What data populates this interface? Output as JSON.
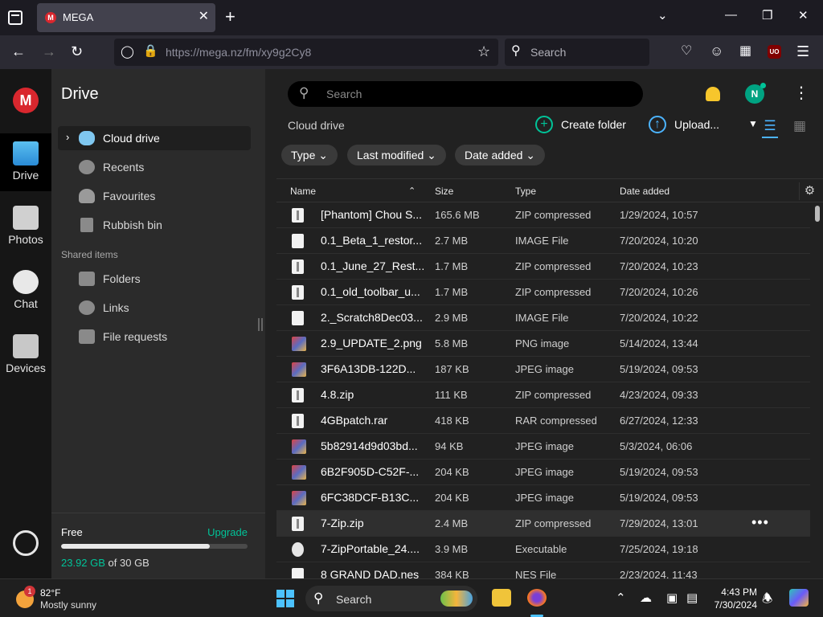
{
  "browser": {
    "tab_title": "MEGA",
    "favicon_letter": "M",
    "tab_close": "✕",
    "new_tab": "+",
    "url": "https://mega.nz/fm/xy9g2Cy8",
    "search_placeholder": "Search",
    "extension_badge": "UO"
  },
  "rail": {
    "logo": "M",
    "items": [
      {
        "label": "Drive",
        "icon": "folder-icon"
      },
      {
        "label": "Photos",
        "icon": "photos-icon"
      },
      {
        "label": "Chat",
        "icon": "chat-icon"
      },
      {
        "label": "Devices",
        "icon": "devices-icon"
      }
    ]
  },
  "sidebar": {
    "title": "Drive",
    "items": [
      {
        "label": "Cloud drive",
        "icon": "cloud-icon"
      },
      {
        "label": "Recents",
        "icon": "clock-icon"
      },
      {
        "label": "Favourites",
        "icon": "heart-icon"
      },
      {
        "label": "Rubbish bin",
        "icon": "trash-icon"
      }
    ],
    "shared_section": "Shared items",
    "shared_items": [
      {
        "label": "Folders",
        "icon": "shared-folder-icon"
      },
      {
        "label": "Links",
        "icon": "link-icon"
      },
      {
        "label": "File requests",
        "icon": "file-request-icon"
      }
    ],
    "storage": {
      "plan": "Free",
      "upgrade": "Upgrade",
      "used": "23.92 GB",
      "total": " of 30 GB",
      "used_fraction": 0.797
    }
  },
  "main": {
    "search_placeholder": "Search",
    "avatar_initial": "N",
    "breadcrumb": "Cloud drive",
    "create_folder": "Create folder",
    "upload": "Upload...",
    "filters": [
      "Type",
      "Last modified",
      "Date added"
    ],
    "columns": {
      "name": "Name",
      "size": "Size",
      "type": "Type",
      "date": "Date added"
    },
    "files": [
      {
        "name": "[Phantom] Chou S...",
        "size": "165.6 MB",
        "type": "ZIP compressed",
        "date": "1/29/2024, 10:57",
        "icon": "zip"
      },
      {
        "name": "0.1_Beta_1_restor...",
        "size": "2.7 MB",
        "type": "IMAGE File",
        "date": "7/20/2024, 10:20",
        "icon": "file"
      },
      {
        "name": "0.1_June_27_Rest...",
        "size": "1.7 MB",
        "type": "ZIP compressed",
        "date": "7/20/2024, 10:23",
        "icon": "zip"
      },
      {
        "name": "0.1_old_toolbar_u...",
        "size": "1.7 MB",
        "type": "ZIP compressed",
        "date": "7/20/2024, 10:26",
        "icon": "zip"
      },
      {
        "name": "2._Scratch8Dec03...",
        "size": "2.9 MB",
        "type": "IMAGE File",
        "date": "7/20/2024, 10:22",
        "icon": "file"
      },
      {
        "name": "2.9_UPDATE_2.png",
        "size": "5.8 MB",
        "type": "PNG image",
        "date": "5/14/2024, 13:44",
        "icon": "img"
      },
      {
        "name": "3F6A13DB-122D...",
        "size": "187 KB",
        "type": "JPEG image",
        "date": "5/19/2024, 09:53",
        "icon": "img"
      },
      {
        "name": "4.8.zip",
        "size": "111 KB",
        "type": "ZIP compressed",
        "date": "4/23/2024, 09:33",
        "icon": "zip"
      },
      {
        "name": "4GBpatch.rar",
        "size": "418 KB",
        "type": "RAR compressed",
        "date": "6/27/2024, 12:33",
        "icon": "zip"
      },
      {
        "name": "5b82914d9d03bd...",
        "size": "94 KB",
        "type": "JPEG image",
        "date": "5/3/2024, 06:06",
        "icon": "img"
      },
      {
        "name": "6B2F905D-C52F-...",
        "size": "204 KB",
        "type": "JPEG image",
        "date": "5/19/2024, 09:53",
        "icon": "img"
      },
      {
        "name": "6FC38DCF-B13C...",
        "size": "204 KB",
        "type": "JPEG image",
        "date": "5/19/2024, 09:53",
        "icon": "img"
      },
      {
        "name": "7-Zip.zip",
        "size": "2.4 MB",
        "type": "ZIP compressed",
        "date": "7/29/2024, 13:01",
        "icon": "zip",
        "hovered": true
      },
      {
        "name": "7-ZipPortable_24....",
        "size": "3.9 MB",
        "type": "Executable",
        "date": "7/25/2024, 19:18",
        "icon": "exe"
      },
      {
        "name": "8 GRAND DAD.nes",
        "size": "384 KB",
        "type": "NES File",
        "date": "2/23/2024, 11:43",
        "icon": "file"
      }
    ]
  },
  "taskbar": {
    "badge": "1",
    "temperature": "82°F",
    "condition": "Mostly sunny",
    "search_placeholder": "Search",
    "time": "4:43 PM",
    "date": "7/30/2024"
  }
}
